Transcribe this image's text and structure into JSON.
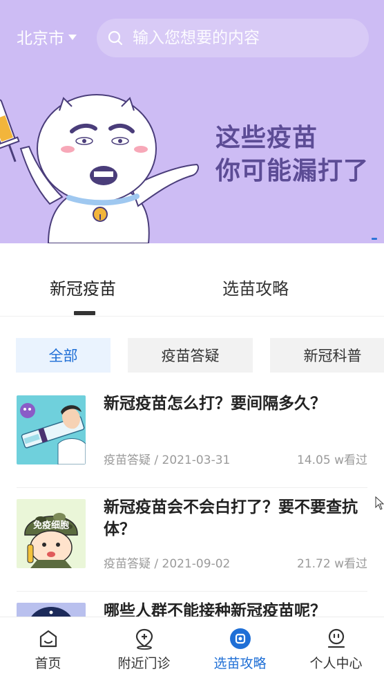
{
  "header": {
    "city": "北京市",
    "search_placeholder": "输入您想要的内容"
  },
  "banner": {
    "headline_line1": "这些疫苗",
    "headline_line2": "你可能漏打了"
  },
  "main_tabs": [
    {
      "label": "新冠疫苗",
      "active": true
    },
    {
      "label": "选苗攻略",
      "active": false
    }
  ],
  "filter_chips": [
    {
      "label": "全部",
      "active": true
    },
    {
      "label": "疫苗答疑",
      "active": false
    },
    {
      "label": "新冠科普",
      "active": false
    }
  ],
  "articles": [
    {
      "title": "新冠疫苗怎么打？要间隔多久？",
      "meta": "疫苗答疑 / 2021-03-31",
      "views": "14.05 w看过",
      "thumb_icon": "vaccine-syringe-illustration"
    },
    {
      "title": "新冠疫苗会不会白打了？要不要查抗体？",
      "meta": "疫苗答疑 / 2021-09-02",
      "views": "21.72 w看过",
      "thumb_icon": "immune-cell-soldier-illustration",
      "thumb_text": "免疫细胞"
    },
    {
      "title": "哪些人群不能接种新冠疫苗呢？",
      "meta": "",
      "views": "",
      "thumb_icon": "dark-illustration"
    }
  ],
  "bottom_nav": [
    {
      "label": "首页",
      "icon": "home-icon",
      "active": false
    },
    {
      "label": "附近门诊",
      "icon": "location-icon",
      "active": false
    },
    {
      "label": "选苗攻略",
      "icon": "guide-icon",
      "active": true
    },
    {
      "label": "个人中心",
      "icon": "user-icon",
      "active": false
    }
  ],
  "colors": {
    "banner_bg": "#cdbcf4",
    "accent": "#1f6fd6",
    "headline": "#5c4c95"
  }
}
